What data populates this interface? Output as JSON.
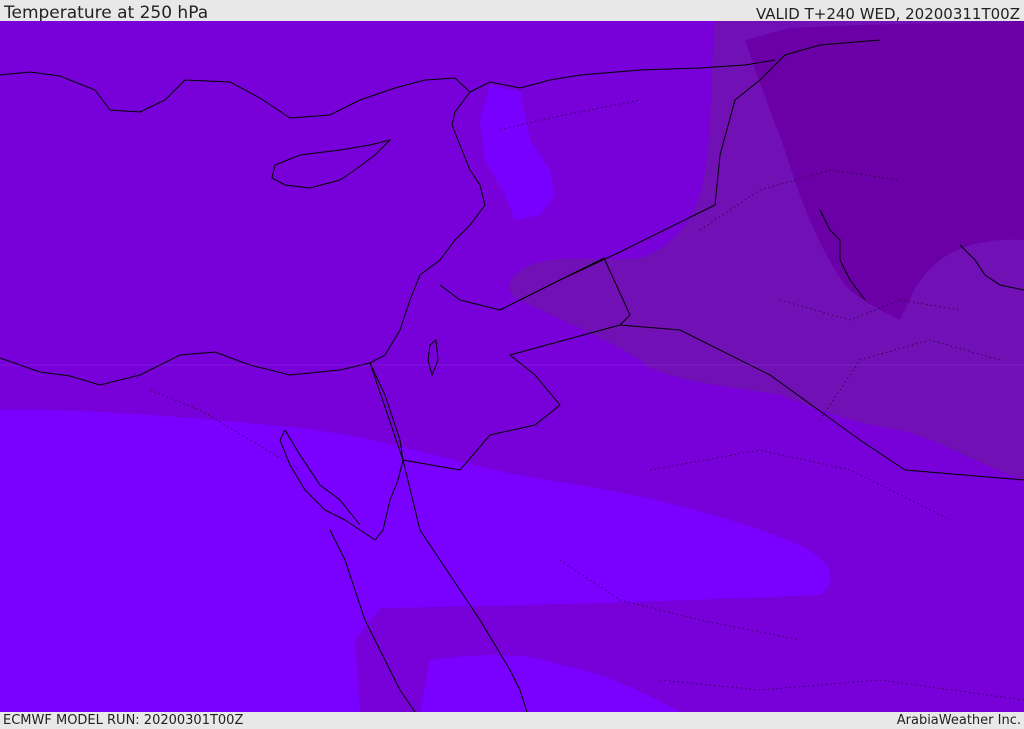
{
  "header": {
    "title": "Temperature at 250 hPa",
    "valid": "VALID T+240 WED, 20200311T00Z"
  },
  "footer": {
    "model_run": "ECMWF MODEL RUN: 20200301T00Z",
    "credit": "ArabiaWeather Inc."
  },
  "colors": {
    "band_darkest": "#6a00a5",
    "band_dark": "#7010b5",
    "band_mid": "#7800d8",
    "band_light": "#7a00ff",
    "band_lighter": "#7a00ff",
    "coastline": "#000000"
  }
}
